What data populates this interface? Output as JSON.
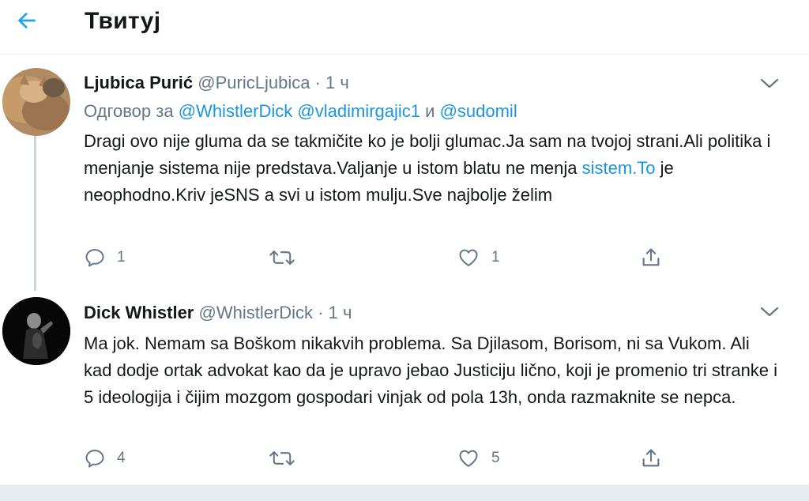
{
  "header": {
    "title": "Твитуј"
  },
  "tweets": [
    {
      "name": "Ljubica Purić",
      "handle": "@PuricLjubica",
      "dot": "·",
      "time": "1 ч",
      "reply_prefix": "Одговор за",
      "reply_mention_1": "@WhistlerDick",
      "reply_mention_2": "@vladimirgajic1",
      "reply_and": "и",
      "reply_mention_3": "@sudomil",
      "text_part_1": "Dragi ovo nije gluma da se takmičite ko je bolji glumac.Ja sam na tvojoj strani.Ali politika i menjanje sistema nije predstava.Valjanje u istom blatu ne menja ",
      "text_link": "sistem.To",
      "text_part_2": " je neophodno.Kriv jeSNS a svi u istom mulju.Sve najbolje želim",
      "replies": "1",
      "retweets": "",
      "likes": "1"
    },
    {
      "name": "Dick Whistler",
      "handle": "@WhistlerDick",
      "dot": "·",
      "time": "1 ч",
      "text": "Ma jok. Nemam sa Boškom nikakvih problema. Sa Djilasom, Borisom, ni sa Vukom. Ali kad dodje ortak advokat kao da je upravo jebao Justiciju lično, koji je promenio tri stranke i 5 ideologija i čijim mozgom gospodari vinjak od pola 13h, onda razmaknite se nepca.",
      "replies": "4",
      "retweets": "",
      "likes": "5"
    }
  ],
  "colors": {
    "accent": "#1b95e0",
    "secondary_text": "#657786",
    "border": "#e6ecf0"
  },
  "icons": [
    "back-arrow-icon",
    "chevron-down-icon",
    "reply-icon",
    "retweet-icon",
    "like-icon",
    "share-icon"
  ]
}
